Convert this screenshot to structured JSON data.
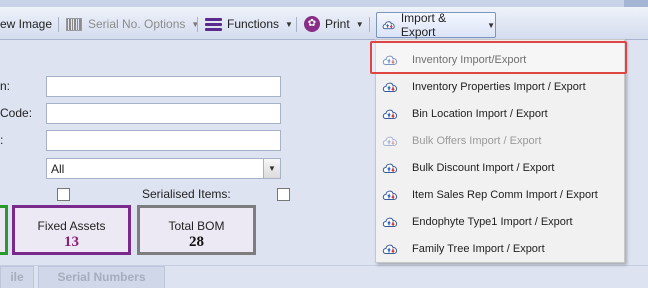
{
  "toolbar": {
    "view_image": "ew Image",
    "serial_options": "Serial No. Options",
    "functions": "Functions",
    "print": "Print",
    "import_export": "Import & Export"
  },
  "form": {
    "label1": "n:",
    "label2": "Code:",
    "label3": ":",
    "select_value": "All",
    "serialised_label": "Serialised Items:"
  },
  "tiles": [
    {
      "title": "Fixed Assets",
      "value": "13",
      "color": "#8a1f7a",
      "border": "#7a2a8c"
    },
    {
      "title": "Total BOM",
      "value": "28",
      "color": "#111111",
      "border": "#7d7d7d"
    }
  ],
  "bottom_tabs": [
    "ile",
    "Serial Numbers"
  ],
  "menu": {
    "items": [
      {
        "label": "Inventory Import/Export",
        "enabled": true,
        "highlighted": true
      },
      {
        "label": "Inventory Properties Import / Export",
        "enabled": true
      },
      {
        "label": "Bin Location Import / Export",
        "enabled": true
      },
      {
        "label": "Bulk Offers Import / Export",
        "enabled": false
      },
      {
        "label": "Bulk Discount Import / Export",
        "enabled": true
      },
      {
        "label": "Item Sales Rep Comm Import / Export",
        "enabled": true
      },
      {
        "label": "Endophyte Type1 Import / Export",
        "enabled": true
      },
      {
        "label": "Family Tree Import / Export",
        "enabled": true
      }
    ]
  },
  "colors": {
    "highlight_border": "#e04545",
    "toolbar_accent": "#5a2a8c"
  }
}
